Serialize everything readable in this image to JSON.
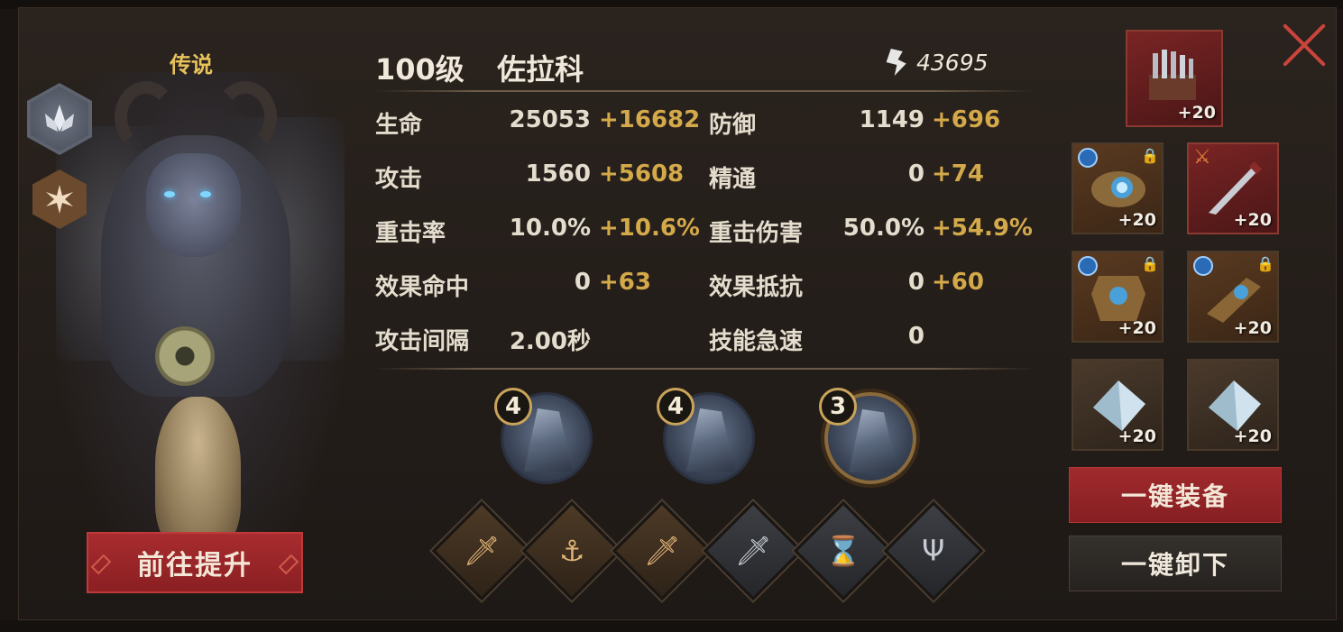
{
  "hero": {
    "rarity": "传说",
    "level_label": "100级",
    "name": "佐拉科",
    "power": "43695",
    "upgrade_label": "前往提升"
  },
  "stats": [
    {
      "label": "生命",
      "base": "25053",
      "bonus": "+16682"
    },
    {
      "label": "防御",
      "base": "1149",
      "bonus": "+696"
    },
    {
      "label": "攻击",
      "base": "1560",
      "bonus": "+5608"
    },
    {
      "label": "精通",
      "base": "0",
      "bonus": "+74"
    },
    {
      "label": "重击率",
      "base": "10.0%",
      "bonus": "+10.6%"
    },
    {
      "label": "重击伤害",
      "base": "50.0%",
      "bonus": "+54.9%"
    },
    {
      "label": "效果命中",
      "base": "0",
      "bonus": "+63"
    },
    {
      "label": "效果抵抗",
      "base": "0",
      "bonus": "+60"
    },
    {
      "label": "攻击间隔",
      "base": "2.00秒",
      "bonus": ""
    },
    {
      "label": "技能急速",
      "base": "0",
      "bonus": ""
    }
  ],
  "set_bonuses": [
    {
      "count": "4",
      "icon": "dark-armor-set-icon"
    },
    {
      "count": "4",
      "icon": "knight-helm-set-icon"
    },
    {
      "count": "3",
      "icon": "army-set-icon"
    }
  ],
  "skills": [
    {
      "icon": "sword-icon",
      "style": "gold"
    },
    {
      "icon": "anchor-sword-icon",
      "style": "gold"
    },
    {
      "icon": "sword-icon",
      "style": "gold"
    },
    {
      "icon": "sword-icon",
      "style": "grey"
    },
    {
      "icon": "hourglass-icon",
      "style": "grey"
    },
    {
      "icon": "trident-icon",
      "style": "grey"
    }
  ],
  "equipment": [
    {
      "slot": "weapon-organ",
      "plus": "+20",
      "locked": false,
      "type": "none"
    },
    {
      "slot": "gloves",
      "plus": "+20",
      "locked": true,
      "type": "blue"
    },
    {
      "slot": "dagger",
      "plus": "+20",
      "locked": false,
      "type": "axe"
    },
    {
      "slot": "chest-armor",
      "plus": "+20",
      "locked": true,
      "type": "blue"
    },
    {
      "slot": "gauntlet",
      "plus": "+20",
      "locked": true,
      "type": "blue"
    },
    {
      "slot": "crystal-1",
      "plus": "+20",
      "locked": false,
      "type": "none"
    },
    {
      "slot": "crystal-2",
      "plus": "+20",
      "locked": false,
      "type": "none"
    }
  ],
  "buttons": {
    "equip_all": "一键装备",
    "unequip_all": "一键卸下"
  },
  "colors": {
    "bonus": "#d4a94a",
    "rarity": "#e6c15c",
    "primary_button": "#a02a2d",
    "close": "#c9443a"
  }
}
